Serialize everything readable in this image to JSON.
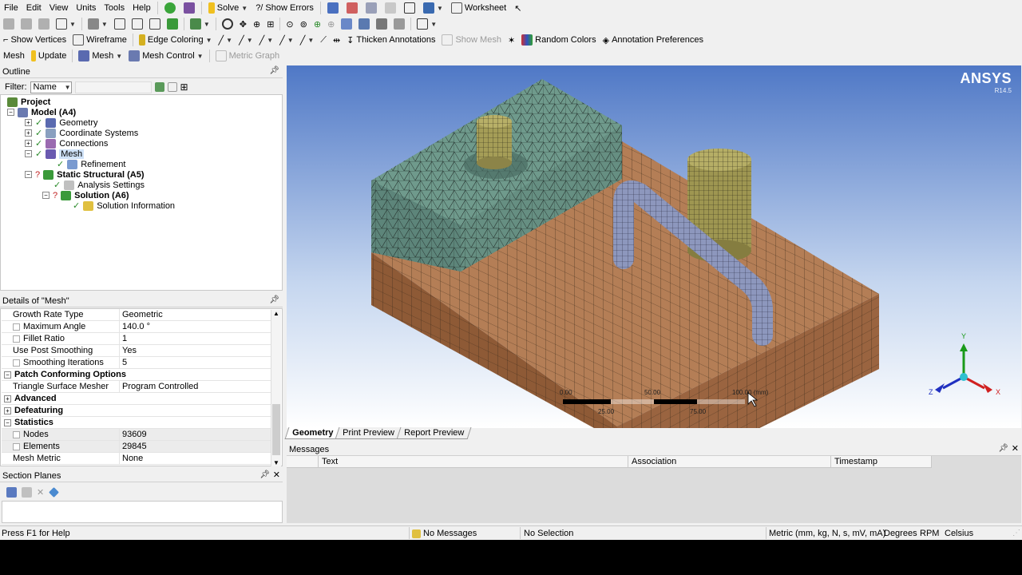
{
  "menubar": {
    "items": [
      "File",
      "Edit",
      "View",
      "Units",
      "Tools",
      "Help"
    ],
    "solve": "Solve",
    "show_errors": "?/ Show Errors",
    "worksheet": "Worksheet"
  },
  "toolbar3": {
    "show_vertices": "Show Vertices",
    "wireframe": "Wireframe",
    "edge_coloring": "Edge Coloring",
    "thicken_annotations": "Thicken Annotations",
    "show_mesh": "Show Mesh",
    "random_colors": "Random Colors",
    "annotation_preferences": "Annotation Preferences"
  },
  "toolbar4": {
    "mesh": "Mesh",
    "update": "Update",
    "mesh_dropdown": "Mesh",
    "mesh_control": "Mesh Control",
    "metric_graph": "Metric Graph"
  },
  "outline": {
    "title": "Outline",
    "filter_label": "Filter:",
    "filter_value": "Name",
    "tree": [
      "Project",
      "Model (A4)",
      "Geometry",
      "Coordinate Systems",
      "Connections",
      "Mesh",
      "Refinement",
      "Static Structural (A5)",
      "Analysis Settings",
      "Solution (A6)",
      "Solution Information"
    ]
  },
  "details": {
    "title": "Details of \"Mesh\"",
    "rows": [
      {
        "k": "Growth Rate Type",
        "v": "Geometric"
      },
      {
        "k": "Maximum Angle",
        "v": "140.0 °"
      },
      {
        "k": "Fillet Ratio",
        "v": "1"
      },
      {
        "k": "Use Post Smoothing",
        "v": "Yes"
      },
      {
        "k": "Smoothing Iterations",
        "v": "5"
      },
      {
        "k": "Patch Conforming Options",
        "v": ""
      },
      {
        "k": "Triangle Surface Mesher",
        "v": "Program Controlled"
      },
      {
        "k": "Advanced",
        "v": ""
      },
      {
        "k": "Defeaturing",
        "v": ""
      },
      {
        "k": "Statistics",
        "v": ""
      },
      {
        "k": "Nodes",
        "v": "93609"
      },
      {
        "k": "Elements",
        "v": "29845"
      },
      {
        "k": "Mesh Metric",
        "v": "None"
      }
    ]
  },
  "section_planes": {
    "title": "Section Planes"
  },
  "viewport": {
    "logo": "ANSYS",
    "version": "R14.5",
    "scale_labels": [
      "0.00",
      "50.00",
      "100.00 (mm)",
      "25.00",
      "75.00"
    ],
    "axis_labels": [
      "Y",
      "Z",
      "X"
    ]
  },
  "tabs": [
    "Geometry",
    "Print Preview",
    "Report Preview"
  ],
  "messages": {
    "title": "Messages",
    "columns": [
      "Text",
      "Association",
      "Timestamp"
    ]
  },
  "status": {
    "help": "Press F1 for Help",
    "messages": "No Messages",
    "selection": "No Selection",
    "units": "Metric (mm, kg, N, s, mV, mA)",
    "angle": "Degrees",
    "rpm": "RPM",
    "temp": "Celsius"
  },
  "colors": {
    "mesh_green": "#6f9a8c",
    "mesh_brown": "#b07a52",
    "mesh_olive": "#a59d57",
    "mesh_blue": "#8d97bd"
  }
}
